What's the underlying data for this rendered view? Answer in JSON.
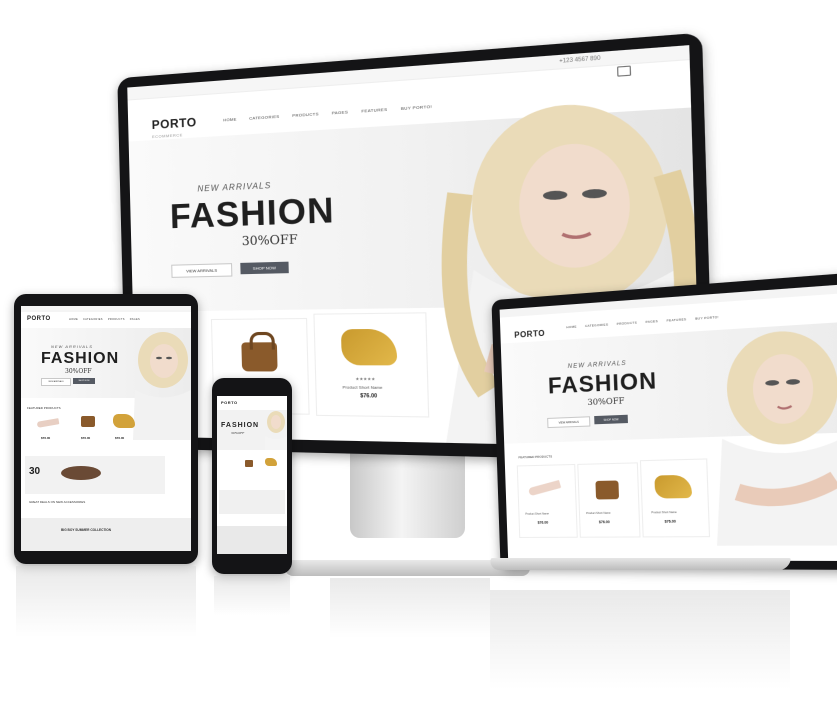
{
  "store": {
    "brand": "PORTO",
    "brand_sub": "ECOMMERCE",
    "phone": "+123 4567 890",
    "nav": [
      "HOME",
      "CATEGORIES",
      "PRODUCTS",
      "PAGES",
      "FEATURES",
      "BUY PORTO!"
    ],
    "hero": {
      "eyebrow": "NEW ARRIVALS",
      "headline": "FASHION",
      "discount": "30%OFF",
      "btn_primary": "VIEW ARRIVALS",
      "btn_secondary": "SHOP NOW"
    },
    "section_title": "FEATURED PRODUCTS",
    "products": [
      {
        "name": "Product Short Name",
        "price": "$76.00",
        "stars": "★★★★★",
        "icon": "shoe-icon"
      },
      {
        "name": "Product Short Name",
        "price": "$76.00",
        "stars": "★★★★★",
        "icon": "handbag-icon"
      },
      {
        "name": "Product Short Name",
        "price": "$76.00",
        "stars": "★★★★★",
        "icon": "scarf-icon"
      }
    ],
    "banner_text": "GREAT DEALS ON NEW ACCESSORIES",
    "bottom_banner": "BIG BOY SUMMER COLLECTION",
    "promo_number": "30"
  },
  "colors": {
    "bezel": "#141416",
    "accent": "#555a63",
    "page_bg": "#ffffff"
  }
}
